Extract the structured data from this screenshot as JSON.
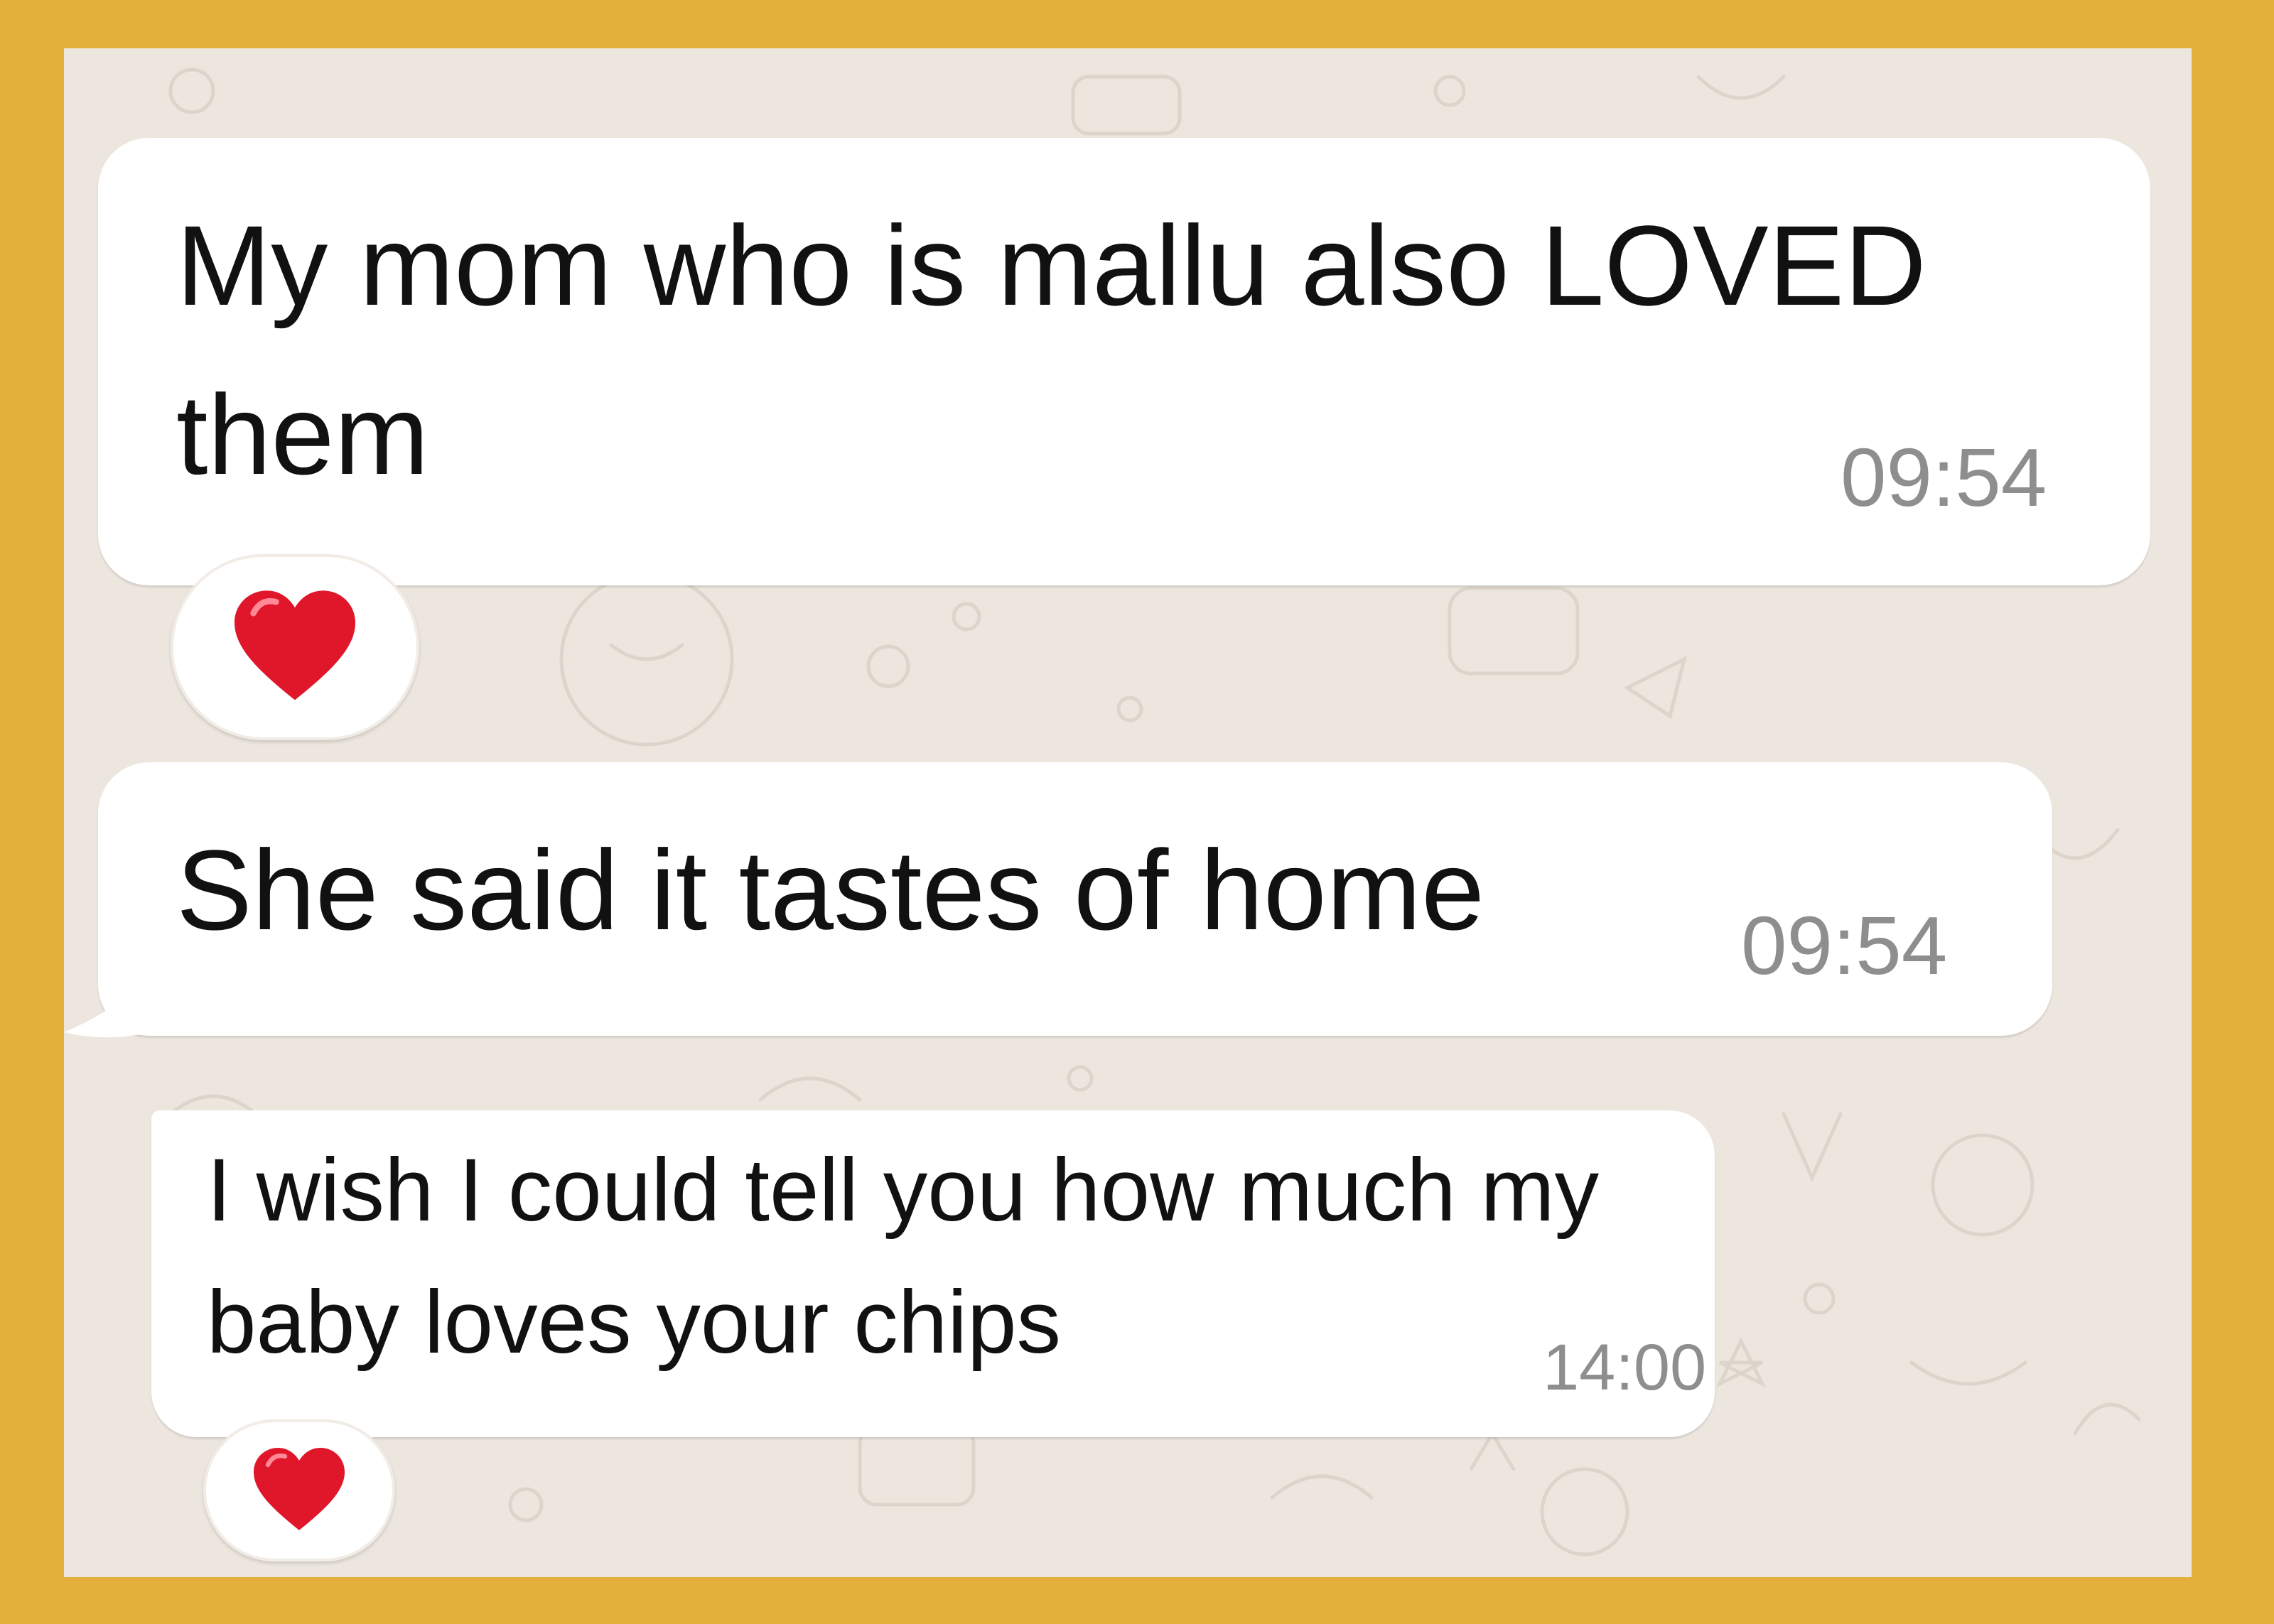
{
  "chat": {
    "messages": [
      {
        "lines": [
          "My mom who is mallu also LOVED",
          "them"
        ],
        "time": "09:54",
        "reaction": "heart-icon"
      },
      {
        "lines": [
          "She said it tastes of home"
        ],
        "time": "09:54"
      },
      {
        "lines": [
          "I wish I could tell you how much my",
          "baby loves your chips"
        ],
        "time": "14:00",
        "reaction": "heart-icon"
      }
    ]
  },
  "colors": {
    "frame_border": "#E2B03B",
    "chat_background": "#ECE6DE",
    "bubble": "#FFFFFF",
    "timestamp": "#8E8E8E",
    "heart": "#E0162B"
  }
}
